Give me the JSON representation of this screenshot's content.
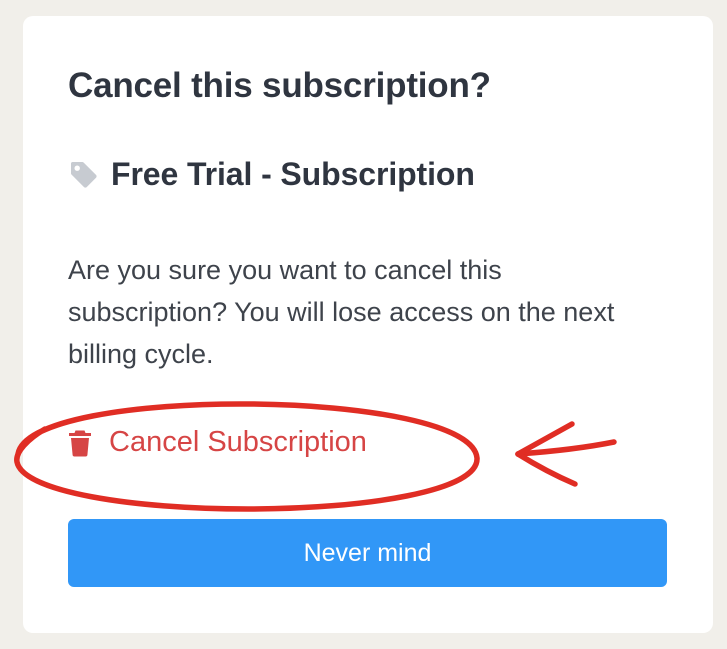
{
  "dialog": {
    "title": "Cancel this subscription?",
    "plan": {
      "name": "Free Trial - Subscription",
      "icon": "tag-icon"
    },
    "message": "Are you sure you want to cancel this subscription? You will lose access on the next billing cycle.",
    "cancel_action": {
      "label": "Cancel Subscription",
      "icon": "trash-icon"
    },
    "dismiss_button": {
      "label": "Never mind"
    }
  },
  "annotation": {
    "shape": "ellipse",
    "pointer": "arrow",
    "color": "#e02d24"
  },
  "colors": {
    "background": "#f1efea",
    "card": "#ffffff",
    "heading_text": "#2f3540",
    "body_text": "#3e434b",
    "danger": "#d64545",
    "primary_button": "#3197f7",
    "tag_icon": "#c7cbd1"
  }
}
